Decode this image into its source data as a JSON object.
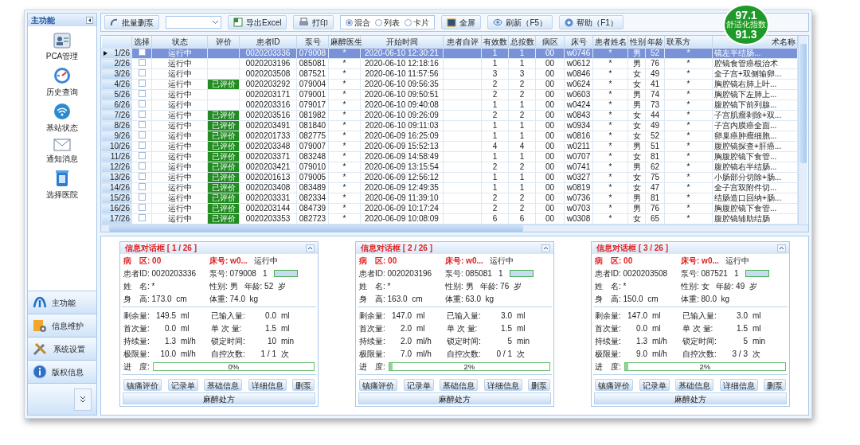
{
  "sidebar": {
    "title": "主功能",
    "items": [
      {
        "label": "PCA管理"
      },
      {
        "label": "历史查询"
      },
      {
        "label": "基站状态"
      },
      {
        "label": "通知消息"
      },
      {
        "label": "选择医院"
      }
    ],
    "nav": [
      {
        "label": "主功能"
      },
      {
        "label": "信息维护"
      },
      {
        "label": "系统设置"
      },
      {
        "label": "版权信息"
      }
    ]
  },
  "toolbar": {
    "batch_delete_button": "批量删泵",
    "export_button": "导出Excel",
    "print_button": "打印",
    "view_modes": [
      {
        "label": "混合",
        "selected": true
      },
      {
        "label": "列表",
        "selected": false
      },
      {
        "label": "卡片",
        "selected": false
      }
    ],
    "fullscreen_button": "全屏",
    "refresh_button": "刷新（F5）",
    "help_button": "帮助（F1）"
  },
  "comfort_badge": {
    "top_value": "97.1",
    "label": "舒适化指数",
    "bottom_value": "91.3"
  },
  "table": {
    "columns": [
      {
        "kind": "index"
      },
      {
        "kind": "check",
        "label": "选择"
      },
      {
        "kind": "status",
        "label": "状态"
      },
      {
        "kind": "evaluation",
        "label": "评价"
      },
      {
        "kind": "text",
        "label": "患者ID"
      },
      {
        "kind": "text",
        "label": "泵号"
      },
      {
        "kind": "text",
        "label": "麻醉医生"
      },
      {
        "kind": "text",
        "label": "开始时间"
      },
      {
        "kind": "empty",
        "label": "患者自评"
      },
      {
        "kind": "text",
        "label": "有效数"
      },
      {
        "kind": "text",
        "label": "总按数"
      },
      {
        "kind": "text",
        "label": "病区"
      },
      {
        "kind": "text",
        "label": "床号"
      },
      {
        "kind": "text",
        "label": "患者姓名"
      },
      {
        "kind": "text",
        "label": "性别"
      },
      {
        "kind": "text",
        "label": "年龄"
      },
      {
        "kind": "text",
        "label": "联系方"
      },
      {
        "kind": "text",
        "label": "术名称"
      }
    ],
    "rows": [
      {
        "selected": true,
        "checked": false,
        "index": "1/26",
        "status": "运行中",
        "values": [
          "0020203336",
          "079008",
          "*",
          "2020-06-10 12:30:21",
          "1",
          "1",
          "00",
          "w0746",
          "*",
          "男",
          "52",
          "*",
          "镜左半结肠..."
        ]
      },
      {
        "selected": false,
        "checked": false,
        "index": "2/26",
        "status": "运行中",
        "values": [
          "0020203196",
          "085081",
          "*",
          "2020-06-10 12:18:16",
          "1",
          "1",
          "00",
          "w0612",
          "*",
          "男",
          "76",
          "*",
          "腔镜食管癌根治术"
        ]
      },
      {
        "selected": false,
        "checked": false,
        "index": "3/26",
        "status": "运行中",
        "values": [
          "0020203508",
          "087521",
          "*",
          "2020-06-10 11:57:56",
          "3",
          "3",
          "00",
          "w0846",
          "*",
          "女",
          "49",
          "*",
          "全子宫+双侧输卵..."
        ]
      },
      {
        "selected": false,
        "checked": false,
        "index": "4/26",
        "status": "运行中",
        "evaluation": "已评价",
        "values": [
          "0020203292",
          "079004",
          "*",
          "2020-06-10 09:56:35",
          "2",
          "2",
          "00",
          "w0624",
          "*",
          "女",
          "41",
          "*",
          "胸腔镜右肺上叶..."
        ]
      },
      {
        "selected": false,
        "checked": false,
        "index": "5/26",
        "status": "运行中",
        "values": [
          "0020203171",
          "079001",
          "*",
          "2020-06-10 09:50:51",
          "2",
          "2",
          "00",
          "w0603",
          "*",
          "男",
          "74",
          "*",
          "胸腔镜下左肺上..."
        ]
      },
      {
        "selected": false,
        "checked": false,
        "index": "6/26",
        "status": "运行中",
        "values": [
          "0020203316",
          "079017",
          "*",
          "2020-06-10 09:40:08",
          "1",
          "1",
          "00",
          "w0424",
          "*",
          "男",
          "73",
          "*",
          "腹腔镜下前列腺..."
        ]
      },
      {
        "selected": false,
        "checked": false,
        "index": "7/26",
        "status": "运行中",
        "evaluation": "已评价",
        "values": [
          "0020203516",
          "081982",
          "*",
          "2020-06-10 09:26:09",
          "2",
          "2",
          "00",
          "w0843",
          "*",
          "女",
          "44",
          "*",
          "子宫肌瘤剥除+双..."
        ]
      },
      {
        "selected": false,
        "checked": false,
        "index": "8/26",
        "status": "运行中",
        "evaluation": "已评价",
        "values": [
          "0020203491",
          "081840",
          "*",
          "2020-06-10 09:11:03",
          "1",
          "1",
          "00",
          "w0934",
          "*",
          "女",
          "49",
          "*",
          "子宫内膜癌全面..."
        ]
      },
      {
        "selected": false,
        "checked": false,
        "index": "9/26",
        "status": "运行中",
        "evaluation": "已评价",
        "values": [
          "0020201733",
          "082775",
          "*",
          "2020-06-09 16:25:09",
          "1",
          "1",
          "00",
          "w0816",
          "*",
          "女",
          "52",
          "*",
          "卵巢癌肿瘤细胞..."
        ]
      },
      {
        "selected": false,
        "checked": false,
        "index": "10/26",
        "status": "运行中",
        "evaluation": "已评价",
        "values": [
          "0020203348",
          "079007",
          "*",
          "2020-06-09 15:52:13",
          "4",
          "4",
          "00",
          "w0211",
          "*",
          "男",
          "51",
          "*",
          "腹腔镜探查+肝癌..."
        ]
      },
      {
        "selected": false,
        "checked": false,
        "index": "11/26",
        "status": "运行中",
        "evaluation": "已评价",
        "values": [
          "0020203371",
          "083248",
          "*",
          "2020-06-09 14:58:49",
          "1",
          "1",
          "00",
          "w0707",
          "*",
          "女",
          "81",
          "*",
          "胸腹腔镜下食管..."
        ]
      },
      {
        "selected": false,
        "checked": false,
        "index": "12/26",
        "status": "运行中",
        "evaluation": "已评价",
        "values": [
          "0020203421",
          "079010",
          "*",
          "2020-06-09 13:15:54",
          "2",
          "2",
          "00",
          "w0741",
          "*",
          "男",
          "62",
          "*",
          "腹腔镜右半结肠..."
        ]
      },
      {
        "selected": false,
        "checked": false,
        "index": "13/26",
        "status": "运行中",
        "evaluation": "已评价",
        "values": [
          "0020201613",
          "079005",
          "*",
          "2020-06-09 12:56:12",
          "1",
          "1",
          "00",
          "w0327",
          "*",
          "女",
          "75",
          "*",
          "小肠部分切除+肠..."
        ]
      },
      {
        "selected": false,
        "checked": false,
        "index": "14/26",
        "status": "运行中",
        "evaluation": "已评价",
        "values": [
          "0020203408",
          "083489",
          "*",
          "2020-06-09 12:49:35",
          "1",
          "1",
          "00",
          "w0819",
          "*",
          "女",
          "47",
          "*",
          "全子宫双附件切..."
        ]
      },
      {
        "selected": false,
        "checked": false,
        "index": "15/26",
        "status": "运行中",
        "evaluation": "已评价",
        "values": [
          "0020203331",
          "082334",
          "*",
          "2020-06-09 11:39:10",
          "2",
          "2",
          "00",
          "w0736",
          "*",
          "男",
          "81",
          "*",
          "结肠造口回纳+肠..."
        ]
      },
      {
        "selected": false,
        "checked": false,
        "index": "16/26",
        "status": "运行中",
        "evaluation": "已评价",
        "values": [
          "0020203144",
          "084739",
          "*",
          "2020-06-09 10:17:24",
          "2",
          "2",
          "00",
          "w0703",
          "*",
          "男",
          "76",
          "*",
          "胸腹腔镜下食管..."
        ]
      },
      {
        "selected": false,
        "checked": false,
        "index": "17/26",
        "status": "运行中",
        "evaluation": "已评价",
        "values": [
          "0020203353",
          "082723",
          "*",
          "2020-06-09 10:08:09",
          "6",
          "6",
          "00",
          "w0308",
          "*",
          "女",
          "65",
          "*",
          "腹腔镜辅助结肠"
        ]
      }
    ]
  },
  "cards": [
    {
      "title": "信息对话框 [ 1 / 26 ]",
      "info": [
        [
          {
            "kind": "alert",
            "label": "病　区:",
            "value": "00"
          },
          {
            "kind": "alert",
            "label": "床号:",
            "value": "w0..."
          },
          {
            "kind": "plain",
            "value": "运行中"
          }
        ],
        [
          {
            "kind": "field",
            "label": "患者ID:",
            "value": "0020203336"
          },
          {
            "kind": "field",
            "label": "泵号:",
            "value": "079008"
          },
          {
            "kind": "plain",
            "value": "1"
          },
          {
            "kind": "meter"
          }
        ],
        [
          {
            "kind": "field",
            "label": "姓　名:",
            "value": "*"
          },
          {
            "kind": "field",
            "label": "性别:",
            "value": "男"
          },
          {
            "kind": "field",
            "label": "年龄:",
            "value": "52",
            "unit": "岁"
          }
        ],
        [
          {
            "kind": "field",
            "label": "身　高:",
            "value": "173.0",
            "unit": "cm"
          },
          {
            "kind": "field",
            "label": "体重:",
            "value": "74.0",
            "unit": "kg"
          }
        ]
      ],
      "metrics": [
        [
          {
            "label": "剩余量:",
            "value": "149.5",
            "unit": "ml"
          },
          {
            "label": "已输入量:",
            "value": "0.0",
            "unit": "ml"
          }
        ],
        [
          {
            "label": "首次量:",
            "value": "0.0",
            "unit": "ml"
          },
          {
            "label": "单 次 量:",
            "value": "1.5",
            "unit": "ml"
          }
        ],
        [
          {
            "label": "持续量:",
            "value": "1.3",
            "unit": "ml/h"
          },
          {
            "label": "锁定时间:",
            "value": "10",
            "unit": "min"
          }
        ],
        [
          {
            "label": "极限量:",
            "value": "10.0",
            "unit": "ml/h"
          },
          {
            "label": "自控次数:",
            "value": "1 / 1",
            "unit": "次"
          }
        ]
      ],
      "progress": {
        "label": "进　度:",
        "level": 0,
        "reading": "0%"
      },
      "buttons": [
        "镇痛评价",
        "记录单",
        "基础信息",
        "详细信息",
        "删泵"
      ],
      "footer_button": "麻醉处方"
    },
    {
      "title": "信息对话框 [ 2 / 26 ]",
      "info": [
        [
          {
            "kind": "alert",
            "label": "病　区:",
            "value": "00"
          },
          {
            "kind": "alert",
            "label": "床号:",
            "value": "w0..."
          },
          {
            "kind": "plain",
            "value": "运行中"
          }
        ],
        [
          {
            "kind": "field",
            "label": "患者ID:",
            "value": "0020203196"
          },
          {
            "kind": "field",
            "label": "泵号:",
            "value": "085081"
          },
          {
            "kind": "plain",
            "value": "1"
          },
          {
            "kind": "meter"
          }
        ],
        [
          {
            "kind": "field",
            "label": "姓　名:",
            "value": "*"
          },
          {
            "kind": "field",
            "label": "性别:",
            "value": "男"
          },
          {
            "kind": "field",
            "label": "年龄:",
            "value": "76",
            "unit": "岁"
          }
        ],
        [
          {
            "kind": "field",
            "label": "身　高:",
            "value": "163.0",
            "unit": "cm"
          },
          {
            "kind": "field",
            "label": "体重:",
            "value": "63.0",
            "unit": "kg"
          }
        ]
      ],
      "metrics": [
        [
          {
            "label": "剩余量:",
            "value": "147.0",
            "unit": "ml"
          },
          {
            "label": "已输入量:",
            "value": "3.0",
            "unit": "ml"
          }
        ],
        [
          {
            "label": "首次量:",
            "value": "2.0",
            "unit": "ml"
          },
          {
            "label": "单 次 量:",
            "value": "1.5",
            "unit": "ml"
          }
        ],
        [
          {
            "label": "持续量:",
            "value": "2.0",
            "unit": "ml/h"
          },
          {
            "label": "锁定时间:",
            "value": "5",
            "unit": "min"
          }
        ],
        [
          {
            "label": "极限量:",
            "value": "7.0",
            "unit": "ml/h"
          },
          {
            "label": "自控次数:",
            "value": "0 / 1",
            "unit": "次"
          }
        ]
      ],
      "progress": {
        "label": "进　度:",
        "level": 0.02,
        "reading": "2%"
      },
      "buttons": [
        "镇痛评价",
        "记录单",
        "基础信息",
        "详细信息",
        "删泵"
      ],
      "footer_button": "麻醉处方"
    },
    {
      "title": "信息对话框 [ 3 / 26 ]",
      "info": [
        [
          {
            "kind": "alert",
            "label": "病　区:",
            "value": "00"
          },
          {
            "kind": "alert",
            "label": "床号:",
            "value": "w0..."
          },
          {
            "kind": "plain",
            "value": "运行中"
          }
        ],
        [
          {
            "kind": "field",
            "label": "患者ID:",
            "value": "0020203508"
          },
          {
            "kind": "field",
            "label": "泵号:",
            "value": "087521"
          },
          {
            "kind": "plain",
            "value": "1"
          },
          {
            "kind": "meter"
          }
        ],
        [
          {
            "kind": "field",
            "label": "姓　名:",
            "value": "*"
          },
          {
            "kind": "field",
            "label": "性别:",
            "value": "女"
          },
          {
            "kind": "field",
            "label": "年龄:",
            "value": "49",
            "unit": "岁"
          }
        ],
        [
          {
            "kind": "field",
            "label": "身　高:",
            "value": "150.0",
            "unit": "cm"
          },
          {
            "kind": "field",
            "label": "体重:",
            "value": "80.0",
            "unit": "kg"
          }
        ]
      ],
      "metrics": [
        [
          {
            "label": "剩余量:",
            "value": "147.0",
            "unit": "ml"
          },
          {
            "label": "已输入量:",
            "value": "3.0",
            "unit": "ml"
          }
        ],
        [
          {
            "label": "首次量:",
            "value": "0.0",
            "unit": "ml"
          },
          {
            "label": "单 次 量:",
            "value": "1.5",
            "unit": "ml"
          }
        ],
        [
          {
            "label": "持续量:",
            "value": "1.3",
            "unit": "ml/h"
          },
          {
            "label": "锁定时间:",
            "value": "5",
            "unit": "min"
          }
        ],
        [
          {
            "label": "极限量:",
            "value": "9.0",
            "unit": "ml/h"
          },
          {
            "label": "自控次数:",
            "value": "3 / 3",
            "unit": "次"
          }
        ]
      ],
      "progress": {
        "label": "进　度:",
        "level": 0.02,
        "reading": "2%"
      },
      "buttons": [
        "镇痛评价",
        "记录单",
        "基础信息",
        "详细信息",
        "删泵"
      ],
      "footer_button": "麻醉处方"
    }
  ]
}
